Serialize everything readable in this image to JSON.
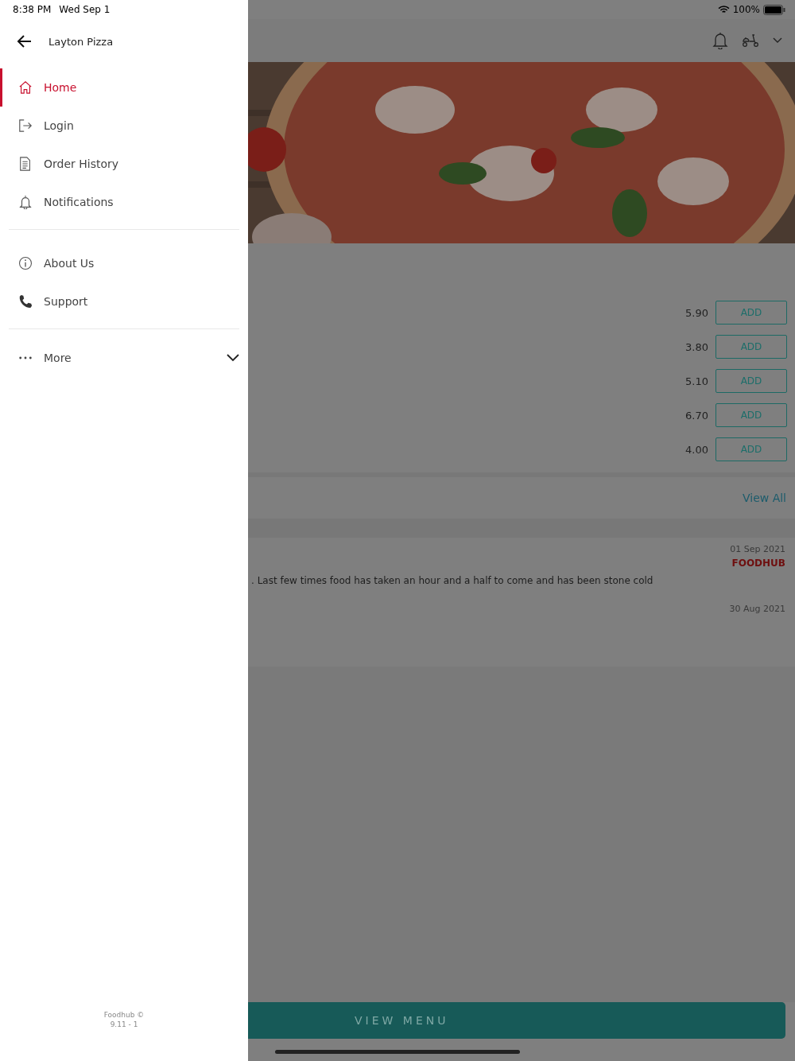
{
  "status_bar": {
    "time": "8:38 PM",
    "date": "Wed Sep 1",
    "battery": "100%"
  },
  "drawer": {
    "title": "Layton Pizza",
    "groups": [
      [
        {
          "label": "Home",
          "kind": "home",
          "selected": true
        },
        {
          "label": "Login",
          "kind": "login",
          "selected": false
        },
        {
          "label": "Order History",
          "kind": "history",
          "selected": false
        },
        {
          "label": "Notifications",
          "kind": "bell",
          "selected": false
        }
      ],
      [
        {
          "label": "About Us",
          "kind": "info",
          "selected": false
        },
        {
          "label": "Support",
          "kind": "phone",
          "selected": false
        }
      ]
    ],
    "more": {
      "label": "More",
      "expanded": false
    },
    "footer": [
      "Foodhub ©",
      "9.11 - 1"
    ]
  },
  "products": [
    {
      "price": "5.90",
      "button": "ADD"
    },
    {
      "price": "3.80",
      "button": "ADD"
    },
    {
      "price": "5.10",
      "button": "ADD"
    },
    {
      "price": "6.70",
      "button": "ADD"
    },
    {
      "price": "4.00",
      "button": "ADD"
    }
  ],
  "view_all": "View All",
  "reviews": [
    {
      "date": "01 Sep 2021",
      "source": "FOODHUB",
      "text": ". Last few times food has taken an hour and a half to come and has been stone cold"
    },
    {
      "date": "30 Aug 2021"
    }
  ],
  "view_menu": "VIEW MENU"
}
